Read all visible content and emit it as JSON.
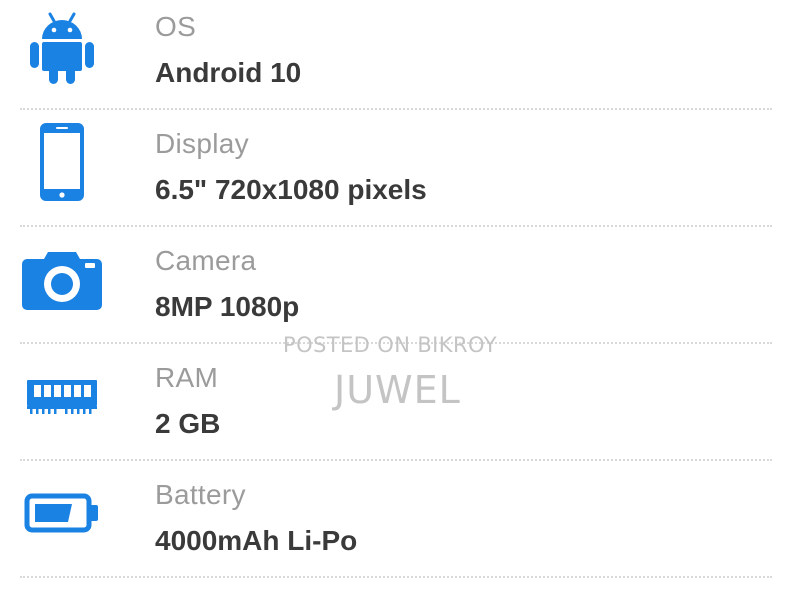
{
  "theme": {
    "icon_color": "#1a82e3",
    "label_color": "#9b9b9b",
    "value_color": "#3a3a3a"
  },
  "specs": [
    {
      "icon": "android-icon",
      "label": "OS",
      "value": "Android 10"
    },
    {
      "icon": "phone-icon",
      "label": "Display",
      "value": "6.5\" 720x1080 pixels"
    },
    {
      "icon": "camera-icon",
      "label": "Camera",
      "value": "8MP 1080p"
    },
    {
      "icon": "memory-icon",
      "label": "RAM",
      "value": "2 GB"
    },
    {
      "icon": "battery-icon",
      "label": "Battery",
      "value": "4000mAh Li-Po"
    }
  ],
  "watermark": {
    "line1": "POSTED ON BIKROY",
    "line2": "JUWEL"
  }
}
